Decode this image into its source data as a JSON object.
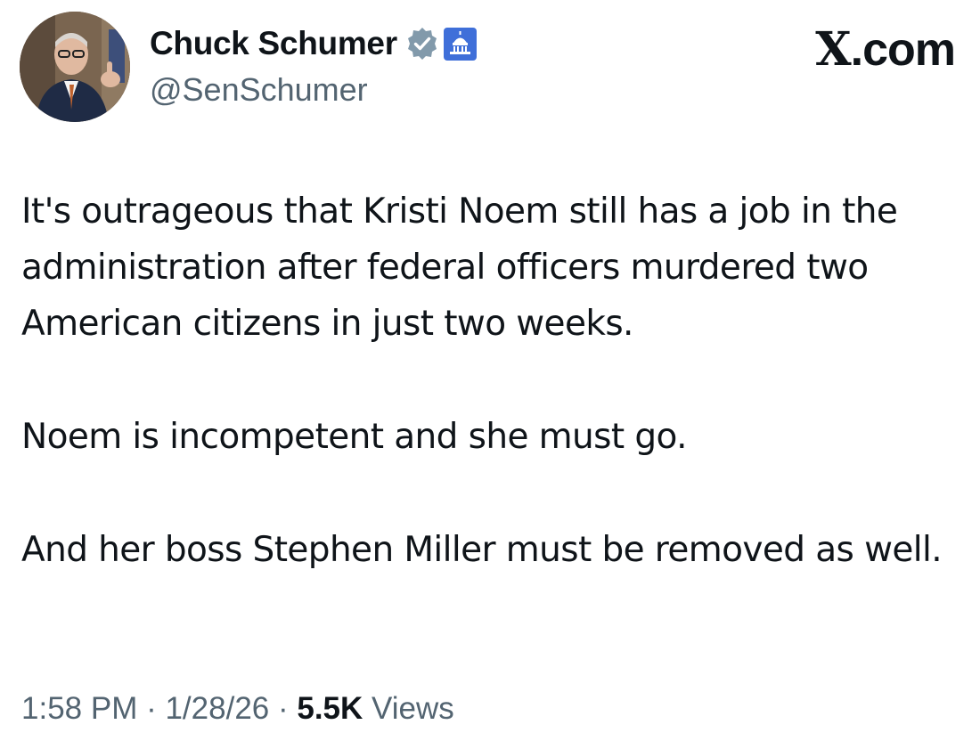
{
  "author": {
    "display_name": "Chuck Schumer",
    "handle": "@SenSchumer",
    "verified_badge_icon": "verified-badge-icon",
    "affiliation_icon": "capitol-dome-icon",
    "avatar_icon": "profile-photo"
  },
  "source": {
    "x_letter": "X",
    "domain_suffix": ".com"
  },
  "tweet": {
    "paragraphs": [
      "It's outrageous that Kristi Noem still has a job in the administration after federal officers murdered two American citizens in just two weeks.",
      "Noem is incompetent and she must go.",
      "And her boss Stephen Miller must be removed as well."
    ]
  },
  "meta": {
    "time": "1:58 PM",
    "separator": " · ",
    "date": "1/28/26",
    "views_count": "5.5K",
    "views_label": " Views"
  },
  "colors": {
    "text_primary": "#0f1419",
    "text_secondary": "#536471",
    "badge_gray": "#829aab",
    "affiliation_blue": "#3f6fd9"
  }
}
